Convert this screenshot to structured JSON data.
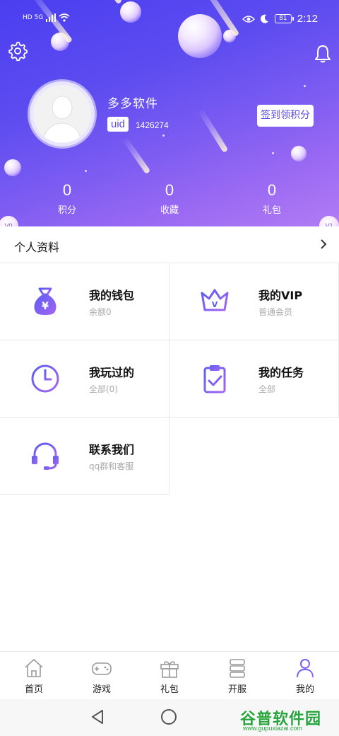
{
  "status_bar": {
    "left_indicators": "HD 5G",
    "battery": "81",
    "time": "2:12"
  },
  "profile": {
    "username": "多多软件",
    "uid_label": "uid",
    "uid_value": "1426274",
    "signin_button": "签到领积分"
  },
  "stats": [
    {
      "value": "0",
      "label": "积分"
    },
    {
      "value": "0",
      "label": "收藏"
    },
    {
      "value": "0",
      "label": "礼包"
    }
  ],
  "levels": {
    "current": "V0",
    "next": "V1"
  },
  "personal_info": {
    "label": "个人资料"
  },
  "menu": [
    {
      "title": "我的钱包",
      "subtitle": "余额0",
      "icon": "money-bag-icon"
    },
    {
      "title": "我的VIP",
      "subtitle": "普通会员",
      "icon": "crown-icon"
    },
    {
      "title": "我玩过的",
      "subtitle": "全部(0)",
      "icon": "clock-icon"
    },
    {
      "title": "我的任务",
      "subtitle": "全部",
      "icon": "clipboard-check-icon"
    },
    {
      "title": "联系我们",
      "subtitle": "qq群和客服",
      "icon": "headset-icon"
    }
  ],
  "tabs": [
    {
      "label": "首页",
      "icon": "home-icon",
      "active": false
    },
    {
      "label": "游戏",
      "icon": "gamepad-icon",
      "active": false
    },
    {
      "label": "礼包",
      "icon": "gift-icon",
      "active": false
    },
    {
      "label": "开服",
      "icon": "server-icon",
      "active": false
    },
    {
      "label": "我的",
      "icon": "user-icon",
      "active": true
    }
  ],
  "watermark": {
    "main": "谷普软件园",
    "url": "www.gupuxiazai.com"
  },
  "colors": {
    "accent": "#5a4be6",
    "gradient_start": "#4a3ef0",
    "gradient_end": "#b27cf4",
    "icon_gradient_a": "#6a5cf0",
    "icon_gradient_b": "#9b6af3"
  }
}
